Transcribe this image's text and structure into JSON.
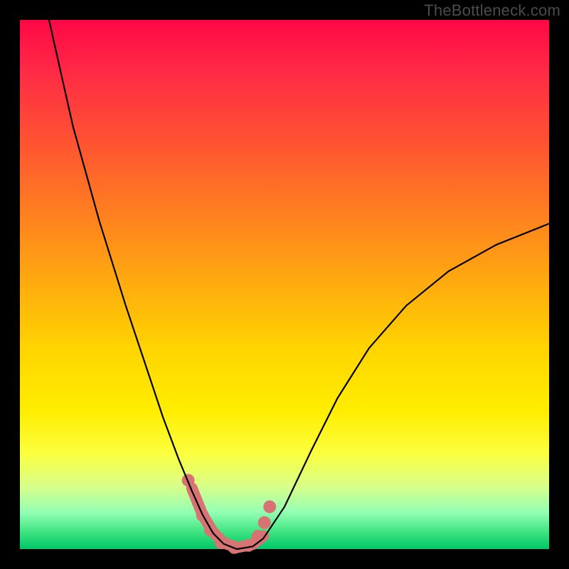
{
  "watermark": "TheBottleneck.com",
  "chart_data": {
    "type": "line",
    "title": "",
    "xlabel": "",
    "ylabel": "",
    "xrange": [
      0,
      1
    ],
    "yrange": [
      0,
      1
    ],
    "series": [
      {
        "name": "black-curve",
        "stroke": "#000000",
        "stroke_width": 2.2,
        "x": [
          0.055,
          0.1,
          0.15,
          0.2,
          0.24,
          0.27,
          0.3,
          0.325,
          0.345,
          0.365,
          0.385,
          0.41,
          0.44,
          0.46,
          0.5,
          0.55,
          0.6,
          0.66,
          0.73,
          0.81,
          0.9,
          1.0
        ],
        "y": [
          1.0,
          0.8,
          0.62,
          0.46,
          0.34,
          0.25,
          0.17,
          0.11,
          0.065,
          0.03,
          0.01,
          0.0,
          0.005,
          0.02,
          0.08,
          0.185,
          0.285,
          0.38,
          0.46,
          0.525,
          0.575,
          0.615
        ]
      },
      {
        "name": "bead-band",
        "stroke": "#d87373",
        "stroke_width": 16,
        "x": [
          0.325,
          0.345,
          0.365,
          0.385,
          0.41,
          0.44,
          0.46
        ],
        "y": [
          0.115,
          0.065,
          0.032,
          0.012,
          0.003,
          0.009,
          0.025
        ]
      }
    ],
    "beads": {
      "color": "#d87373",
      "r": 9,
      "points": [
        {
          "x": 0.318,
          "y": 0.13
        },
        {
          "x": 0.345,
          "y": 0.064
        },
        {
          "x": 0.36,
          "y": 0.036
        },
        {
          "x": 0.38,
          "y": 0.012
        },
        {
          "x": 0.405,
          "y": 0.003
        },
        {
          "x": 0.432,
          "y": 0.007
        },
        {
          "x": 0.45,
          "y": 0.024
        },
        {
          "x": 0.462,
          "y": 0.05
        },
        {
          "x": 0.472,
          "y": 0.08
        }
      ]
    },
    "gradient_stops": [
      {
        "pos": 0.0,
        "color": "#ff0747"
      },
      {
        "pos": 0.5,
        "color": "#ffcf00"
      },
      {
        "pos": 0.85,
        "color": "#f9ff55"
      },
      {
        "pos": 1.0,
        "color": "#00c668"
      }
    ]
  }
}
